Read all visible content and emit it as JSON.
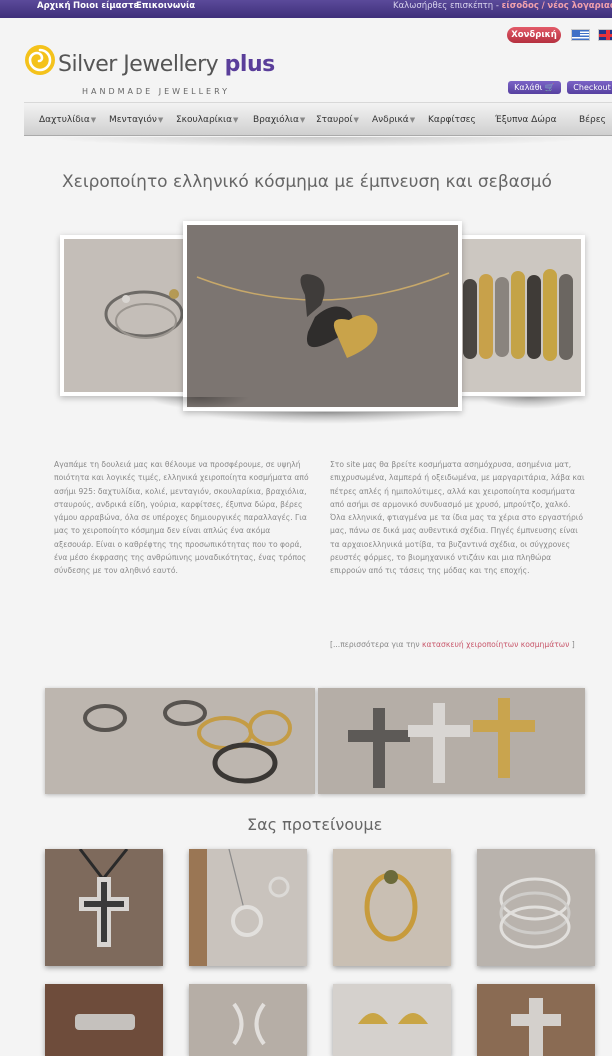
{
  "topbar": {
    "links": [
      "Αρχική",
      "Ποιοι είμαστε",
      "Επικοινωνία"
    ],
    "welcome_text": "Καλωσήρθες επισκέπτη -",
    "login_link": "είσοδος",
    "separator": "/",
    "register_link": "νέος λογαριασμός"
  },
  "header": {
    "logo_text": "Silver Jewellery",
    "logo_plus": "plus",
    "tagline": "HANDMADE JEWELLERY",
    "wholesale_button": "Χονδρική",
    "cart_button": "Καλάθι",
    "checkout_button": "Checkout"
  },
  "nav": {
    "items": [
      {
        "label": "Δαχτυλίδια",
        "dropdown": true
      },
      {
        "label": "Μενταγιόν",
        "dropdown": true
      },
      {
        "label": "Σκουλαρίκια",
        "dropdown": true
      },
      {
        "label": "Βραχιόλια",
        "dropdown": true
      },
      {
        "label": "Σταυροί",
        "dropdown": true
      },
      {
        "label": "Ανδρικά",
        "dropdown": true
      },
      {
        "label": "Καρφίτσες",
        "dropdown": false
      },
      {
        "label": "Έξυπνα Δώρα",
        "dropdown": false
      },
      {
        "label": "Βέρες",
        "dropdown": false
      }
    ]
  },
  "headline": "Χειροποίητο ελληνικό κόσμημα με έμπνευση και σεβασμό",
  "intro": {
    "left_paragraph": "Αγαπάμε τη δουλειά μας και θέλουμε να προσφέρουμε, σε υψηλή ποιότητα και λογικές τιμές, ελληνικά χειροποίητα κοσμήματα από ασήμι 925: δαχτυλίδια, κολιέ, μενταγιόν, σκουλαρίκια, βραχιόλια, σταυρούς, ανδρικά είδη, γούρια, καρφίτσες, έξυπνα δώρα, βέρες γάμου αρραβώνα, όλα σε υπέροχες δημιουργικές παραλλαγές. Για μας το χειροποίητο κόσμημα δεν είναι απλώς ένα ακόμα αξεσουάρ. Είναι ο καθρέφτης της προσωπικότητας που το φορά, ένα μέσο έκφρασης της ανθρώπινης μοναδικότητας, ένας τρόπος σύνδεσης με τον αληθινό εαυτό.",
    "right_paragraph": "Στο site μας θα βρείτε κοσμήματα ασημόχρυσα, ασημένια ματ, επιχρυσωμένα, λαμπερά ή οξειδωμένα, με μαργαριτάρια, λάβα και πέτρες απλές ή ημιπολύτιμες, αλλά και χειροποίητα κοσμήματα από ασήμι σε αρμονικό συνδυασμό με χρυσό, μπρούτζο, χαλκό. Όλα ελληνικά, φτιαγμένα με τα ίδια μας τα χέρια στο εργαστήριό μας, πάνω σε δικά μας αυθεντικά σχέδια. Πηγές έμπνευσης είναι τα αρχαιοελληνικά μοτίβα, τα βυζαντινά σχέδια, οι σύγχρονες ρευστές φόρμες, το βιομηχανικό ντιζάιν και μια πληθώρα επιρροών από τις τάσεις της μόδας και της εποχής.",
    "more_prefix": "[...περισσότερα για την",
    "more_link": "κατασκευή χειροποίητων κοσμημάτων",
    "more_suffix": "]"
  },
  "section_title": "Σας προτείνουμε",
  "colors": {
    "topbar": "#4a3a8a",
    "accent_red": "#c8566a",
    "purple": "#5a3e9a"
  }
}
